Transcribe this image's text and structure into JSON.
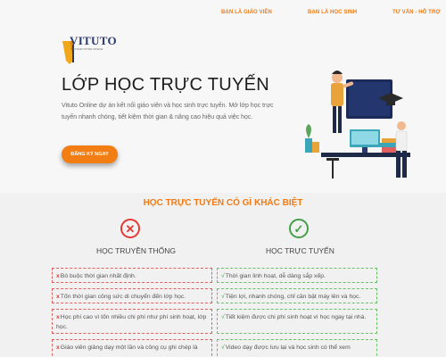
{
  "nav": {
    "items": [
      "BẠN LÀ GIÁO VIÊN",
      "BẠN LÀ HỌC SINH",
      "TƯ VẤN - HỖ TRỢ"
    ]
  },
  "hero": {
    "logo_text": "VITUTO",
    "logo_tagline": "VIETNAM TUTOR ONLINE",
    "title": "LỚP HỌC TRỰC TUYẾN",
    "description": "Vituto Online dự án kết nối giáo viên và học sinh trực tuyến. Mở lớp học trực tuyến nhanh chóng, tiết kiệm thời gian & nâng cao hiệu quả việc học.",
    "cta_label": "ĐĂNG KÝ NGAY"
  },
  "compare": {
    "title": "HỌC TRỰC TUYẾN CÓ GÌ KHÁC BIỆT",
    "left_heading": "HỌC TRUYỀN THỐNG",
    "right_heading": "HỌC TRỰC TUYẾN",
    "cross_mark": "x",
    "check_mark": "√",
    "rows": [
      {
        "left": "Bó buộc thời gian nhất định.",
        "right": "Thời gian linh hoạt, dễ dàng sắp xếp."
      },
      {
        "left": "Tốn thời gian công sức di chuyển đến lớp học.",
        "right": "Tiện lợi, nhanh chóng, chỉ cần bật máy lên và học."
      },
      {
        "left": "Học phí cao vì tốn nhiều chi phí như phí sinh hoạt, lớp học.",
        "right": "Tiết kiệm được chi phí sinh hoạt vì học ngay tại nhà."
      },
      {
        "left": "Giáo viên giảng dạy một lần và công cụ ghi chép là",
        "right": "Video dạy được lưu lại và học sinh có thể xem"
      }
    ]
  },
  "colors": {
    "accent": "#f07b16",
    "danger": "#e53935",
    "success": "#43a047",
    "hero_bg": "#f7f7f7",
    "section_bg": "#f1f1f1"
  }
}
